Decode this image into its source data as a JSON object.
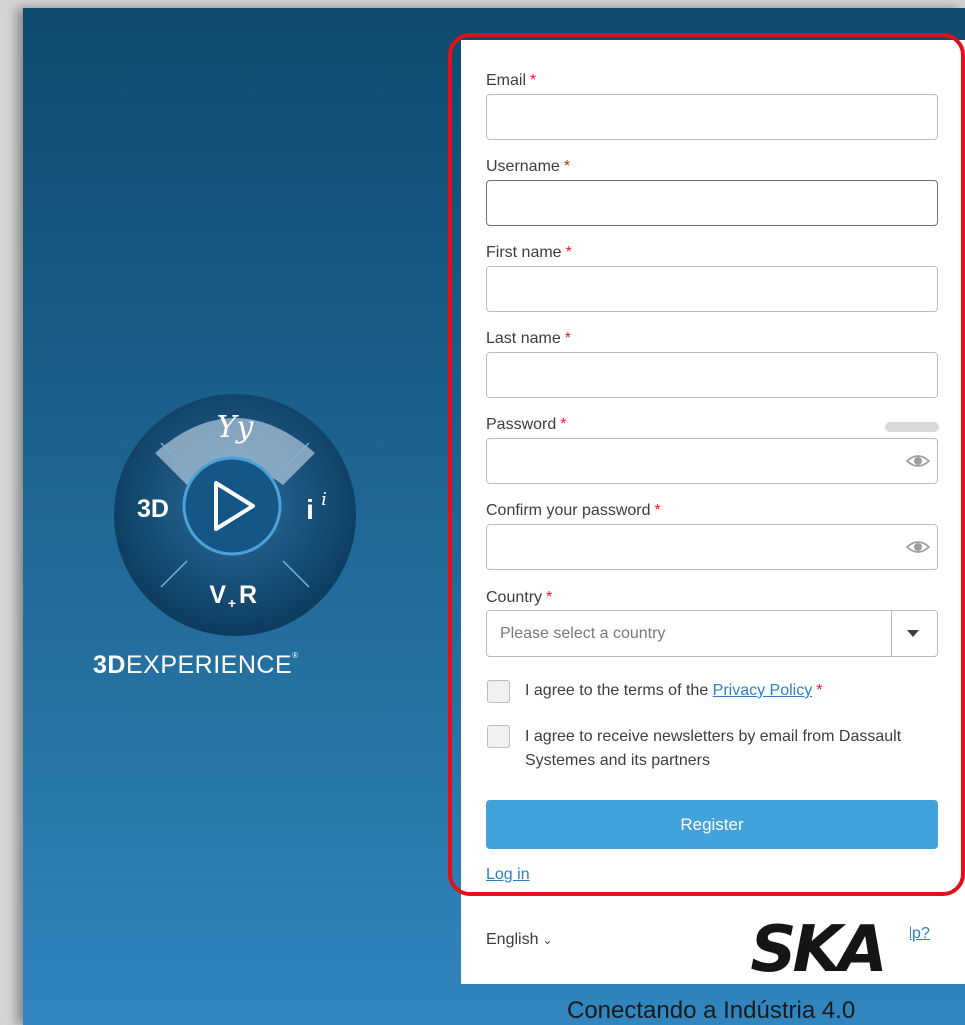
{
  "brand": {
    "prefix": "3D",
    "name": "EXPERIENCE",
    "registered": "®"
  },
  "compass": {
    "top": "Yy",
    "left": "3D",
    "right": "i",
    "right_sup": "i",
    "bottom": "V",
    "bottom_sub": "+",
    "bottom_end": "R"
  },
  "form": {
    "required_mark": "*",
    "email": {
      "label": "Email",
      "value": ""
    },
    "username": {
      "label": "Username",
      "value": ""
    },
    "first_name": {
      "label": "First name",
      "value": ""
    },
    "last_name": {
      "label": "Last name",
      "value": ""
    },
    "password": {
      "label": "Password",
      "value": ""
    },
    "confirm_password": {
      "label": "Confirm your password",
      "value": ""
    },
    "country": {
      "label": "Country",
      "placeholder": "Please select a country"
    },
    "privacy": {
      "prefix": "I agree to the terms of the ",
      "link": "Privacy Policy",
      "checked": false
    },
    "newsletter": {
      "line1": "I agree to receive newsletters by email from Dassault",
      "line2": "Systemes and its partners",
      "checked": false
    },
    "register_label": "Register",
    "login_label": "Log in"
  },
  "footer": {
    "language": "English",
    "help": "Need help?"
  },
  "watermark": {
    "logo_text": "SKA",
    "tagline": "Conectando a Indústria 4.0"
  },
  "colors": {
    "background_top": "#0f4a6d",
    "background_bottom": "#3186bf",
    "primary_button": "#42a2da",
    "link": "#2f7ec0",
    "required": "#e01f1f",
    "highlight": "#e2101a"
  }
}
